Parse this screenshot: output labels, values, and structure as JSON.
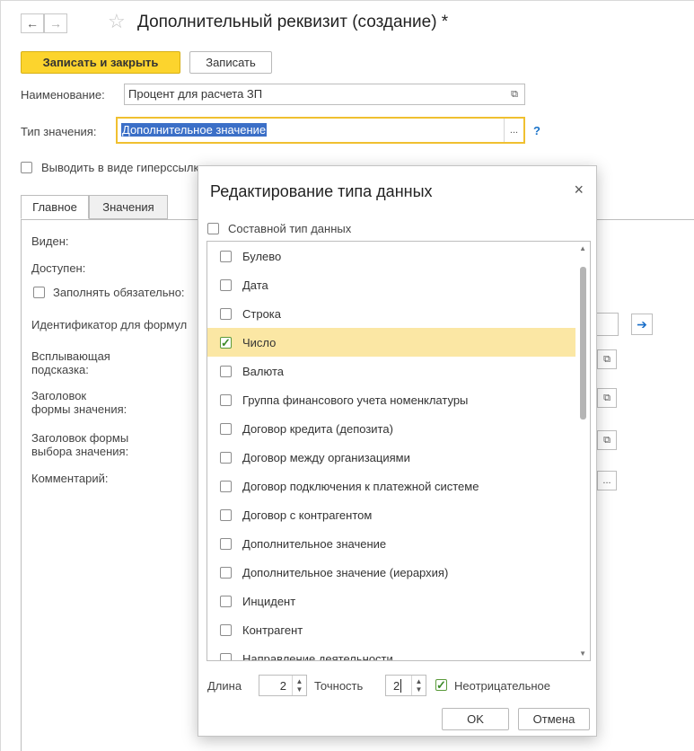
{
  "window": {
    "title": "Дополнительный реквизит (создание) *",
    "back_arrow": "←",
    "forward_arrow": "→",
    "star": "☆"
  },
  "toolbar": {
    "save_close": "Записать и закрыть",
    "save": "Записать"
  },
  "form": {
    "name_label": "Наименование:",
    "name_value": "Процент для расчета ЗП",
    "type_label": "Тип значения:",
    "type_value": "Дополнительное значение",
    "help": "?",
    "hyperlink_label": "Выводить в виде гиперссылки",
    "open_icon": "⧉",
    "dots": "..."
  },
  "tabs": [
    {
      "label": "Главное"
    },
    {
      "label": "Значения"
    }
  ],
  "main_tab": {
    "visible": "Виден:",
    "available": "Доступен:",
    "required": "Заполнять обязательно:",
    "identifier": "Идентификатор для формул",
    "tooltip": "Всплывающая\nподсказка:",
    "header_value": "Заголовок\nформы значения:",
    "header_choice": "Заголовок формы\nвыбора значения:",
    "comment": "Комментарий:",
    "go_icon": "➔"
  },
  "dialog": {
    "title": "Редактирование типа данных",
    "close": "×",
    "composite": "Составной тип данных",
    "types": [
      {
        "label": "Булево",
        "checked": false
      },
      {
        "label": "Дата",
        "checked": false
      },
      {
        "label": "Строка",
        "checked": false
      },
      {
        "label": "Число",
        "checked": true
      },
      {
        "label": "Валюта",
        "checked": false
      },
      {
        "label": "Группа финансового учета номенклатуры",
        "checked": false
      },
      {
        "label": "Договор кредита (депозита)",
        "checked": false
      },
      {
        "label": "Договор между организациями",
        "checked": false
      },
      {
        "label": "Договор подключения к платежной системе",
        "checked": false
      },
      {
        "label": "Договор с контрагентом",
        "checked": false
      },
      {
        "label": "Дополнительное значение",
        "checked": false
      },
      {
        "label": "Дополнительное значение (иерархия)",
        "checked": false
      },
      {
        "label": "Инцидент",
        "checked": false
      },
      {
        "label": "Контрагент",
        "checked": false
      },
      {
        "label": "Направление деятельности",
        "checked": false
      }
    ],
    "length_label": "Длина",
    "length_value": "2",
    "precision_label": "Точность",
    "precision_value": "2",
    "nonnegative_label": "Неотрицательное",
    "ok": "OK",
    "cancel": "Отмена",
    "check_mark": "✓"
  },
  "colors": {
    "accent": "#fcd42d",
    "selection": "#fbe7a4",
    "focus": "#f0c030"
  }
}
